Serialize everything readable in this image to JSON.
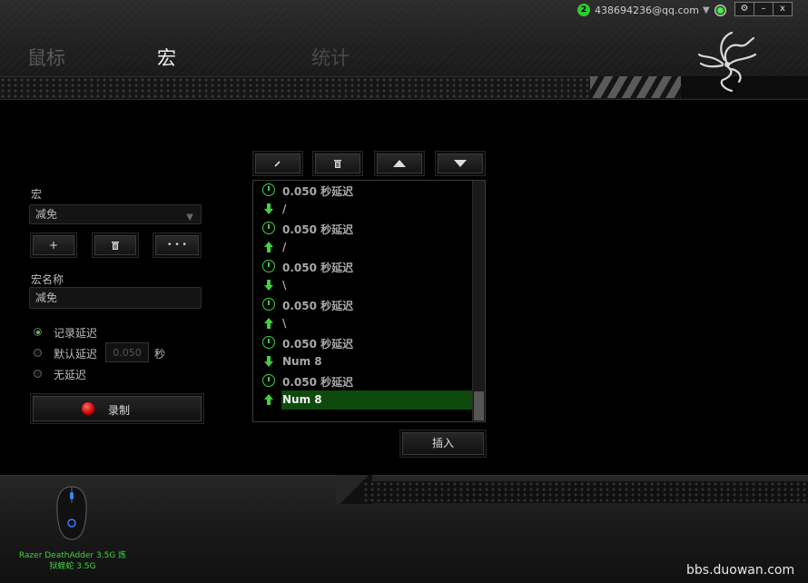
{
  "account": {
    "badge": "2",
    "email": "438694236@qq.com",
    "dropdown_icon": "caret-down-icon",
    "status_icon": "synapse-status-icon"
  },
  "window": {
    "settings_icon": "gear-icon",
    "minimize": "–",
    "close": "x"
  },
  "tabs": [
    {
      "label": "鼠标",
      "active": false
    },
    {
      "label": "宏",
      "active": true
    },
    {
      "label": "统计",
      "active": false
    }
  ],
  "macro_panel": {
    "macro_label": "宏",
    "selected_macro": "减免",
    "add_button": "+",
    "delete_icon": "trash-icon",
    "more_button": "• • •",
    "name_label": "宏名称",
    "name_value": "减免",
    "delay_options": [
      {
        "label": "记录延迟",
        "selected": true
      },
      {
        "label": "默认延迟",
        "selected": false
      },
      {
        "label": "无延迟",
        "selected": false
      }
    ],
    "default_delay_value": "0.050",
    "default_delay_unit": "秒",
    "record_button": "录制"
  },
  "toolbar": {
    "edit_icon": "pencil-icon",
    "delete_icon": "trash-icon",
    "up_icon": "move-up-icon",
    "down_icon": "move-down-icon"
  },
  "macro_steps": [
    {
      "type": "delay",
      "text": "0.050 秒延迟"
    },
    {
      "type": "keydown",
      "text": "/"
    },
    {
      "type": "delay",
      "text": "0.050 秒延迟"
    },
    {
      "type": "keyup",
      "text": "/"
    },
    {
      "type": "delay",
      "text": "0.050 秒延迟"
    },
    {
      "type": "keydown",
      "text": "\\"
    },
    {
      "type": "delay",
      "text": "0.050 秒延迟"
    },
    {
      "type": "keyup",
      "text": "\\"
    },
    {
      "type": "delay",
      "text": "0.050 秒延迟"
    },
    {
      "type": "keydown",
      "text": "Num 8"
    },
    {
      "type": "delay",
      "text": "0.050 秒延迟"
    },
    {
      "type": "keyup",
      "text": "Num 8",
      "selected": true
    }
  ],
  "insert_button": "插入",
  "device": {
    "name_line1": "Razer DeathAdder 3.5G 炼",
    "name_line2": "狱蝰蛇 3.5G"
  },
  "watermark": "bbs.duowan.com",
  "colors": {
    "accent": "#3fd23f",
    "selection": "#0e4a0e",
    "record": "#d00000"
  }
}
